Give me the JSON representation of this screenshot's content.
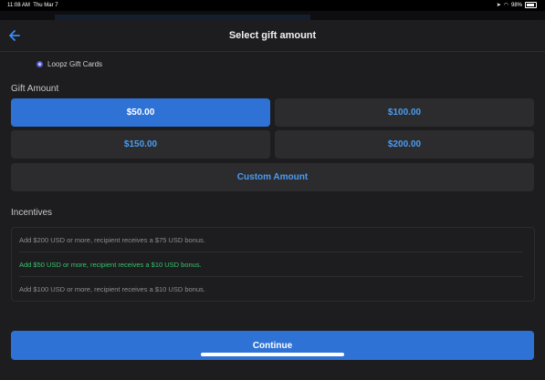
{
  "status": {
    "time": "11:08 AM",
    "date": "Thu Mar 7",
    "battery": "98%"
  },
  "header": {
    "title": "Select gift amount",
    "back_icon": "arrow-left-icon"
  },
  "merchant": {
    "name": "Loopz Gift Cards"
  },
  "gift_amount": {
    "label": "Gift Amount",
    "options": [
      {
        "label": "$50.00",
        "selected": true
      },
      {
        "label": "$100.00",
        "selected": false
      },
      {
        "label": "$150.00",
        "selected": false
      },
      {
        "label": "$200.00",
        "selected": false
      }
    ],
    "custom_label": "Custom Amount"
  },
  "incentives": {
    "label": "Incentives",
    "items": [
      {
        "text": "Add $200 USD or more, recipient receives a $75 USD bonus.",
        "active": false
      },
      {
        "text": "Add $50 USD or more, recipient receives a $10 USD bonus.",
        "active": true
      },
      {
        "text": "Add $100 USD or more, recipient receives a $10 USD bonus.",
        "active": false
      }
    ]
  },
  "footer": {
    "continue_label": "Continue"
  },
  "colors": {
    "background": "#1d1d1f",
    "card": "#2c2c2e",
    "accent": "#2f72d6",
    "link": "#4a9cf2",
    "success": "#34c46d",
    "muted": "#8e8e93"
  }
}
